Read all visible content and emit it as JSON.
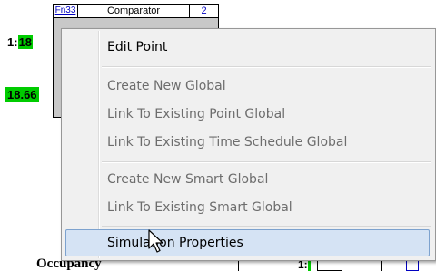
{
  "block": {
    "fn_id": "Fn33",
    "fn_name": "Comparator",
    "fn_count": "2",
    "left_value_prefix": "1:",
    "left_value_highlight": "18",
    "lower_value": "18.66",
    "bottom_label": "Occupancy",
    "bottom_number": "1:"
  },
  "context_menu": {
    "items": [
      {
        "label": "Edit Point",
        "enabled": true
      },
      {
        "label": "Create New Global",
        "enabled": false
      },
      {
        "label": "Link To Existing Point Global",
        "enabled": false
      },
      {
        "label": "Link To Existing Time Schedule Global",
        "enabled": false
      },
      {
        "label": "Create New Smart Global",
        "enabled": false
      },
      {
        "label": "Link To Existing Smart Global",
        "enabled": false
      },
      {
        "label": "Simulation Properties",
        "enabled": true,
        "hovered": true
      }
    ]
  },
  "colors": {
    "menu_bg": "#f0f0f0",
    "hover_bg": "#d5e3f4",
    "hover_border": "#7da2ce",
    "value_highlight": "#00cc00",
    "disabled_text": "#6d6d6d"
  }
}
